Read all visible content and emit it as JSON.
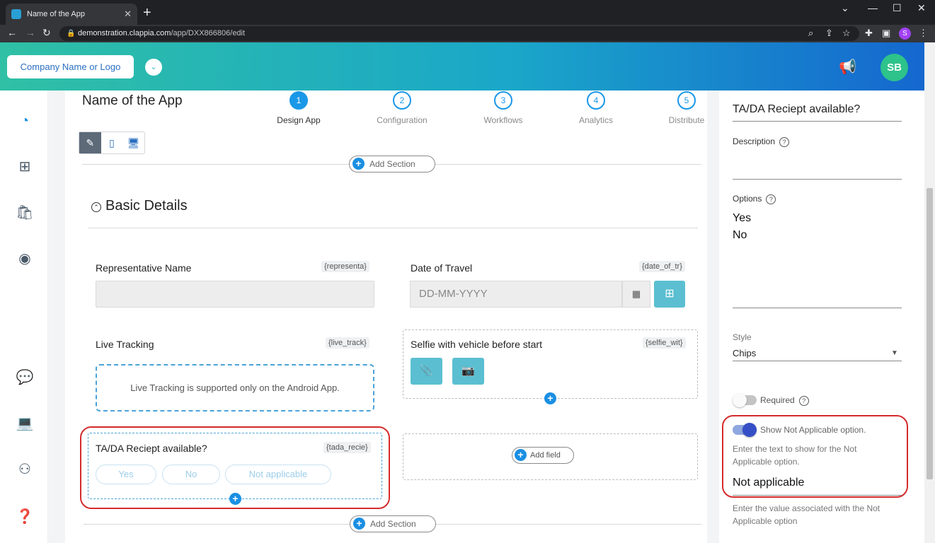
{
  "browser": {
    "tab_title": "Name of the App",
    "url_host": "demonstration.clappia.com",
    "url_path": "/app/DXX866806/edit",
    "profile_initial": "S"
  },
  "header": {
    "company_label": "Company Name or Logo",
    "avatar_initials": "SB"
  },
  "app": {
    "title": "Name of the App",
    "steps": [
      {
        "num": "1",
        "label": "Design App"
      },
      {
        "num": "2",
        "label": "Configuration"
      },
      {
        "num": "3",
        "label": "Workflows"
      },
      {
        "num": "4",
        "label": "Analytics"
      },
      {
        "num": "5",
        "label": "Distribute"
      }
    ],
    "add_section_label": "Add Section",
    "section_title": "Basic Details"
  },
  "fields": {
    "rep_name": {
      "label": "Representative Name",
      "var": "{representa}"
    },
    "date_travel": {
      "label": "Date of Travel",
      "var": "{date_of_tr}",
      "placeholder": "DD-MM-YYYY"
    },
    "live_tracking": {
      "label": "Live Tracking",
      "var": "{live_track}",
      "message": "Live Tracking is supported only on the Android App."
    },
    "selfie": {
      "label": "Selfie with vehicle before start",
      "var": "{selfie_wit}"
    },
    "tada": {
      "label": "TA/DA Reciept available?",
      "var": "{tada_recie}",
      "chips": [
        "Yes",
        "No",
        "Not applicable"
      ]
    },
    "add_field_label": "Add field"
  },
  "right_panel": {
    "field_title": "TA/DA Reciept available?",
    "description_label": "Description",
    "options_label": "Options",
    "options": [
      "Yes",
      "No"
    ],
    "style_label": "Style",
    "style_value": "Chips",
    "required_label": "Required",
    "required_on": false,
    "show_na_label": "Show Not Applicable option.",
    "show_na_on": true,
    "na_text_help": "Enter the text to show for the Not Applicable option.",
    "na_text_value": "Not applicable",
    "na_value_help": "Enter the value associated with the Not Applicable option"
  },
  "colors": {
    "accent": "#1a98e8",
    "highlight": "#d42b2b",
    "button_teal": "#5bbfd1"
  }
}
